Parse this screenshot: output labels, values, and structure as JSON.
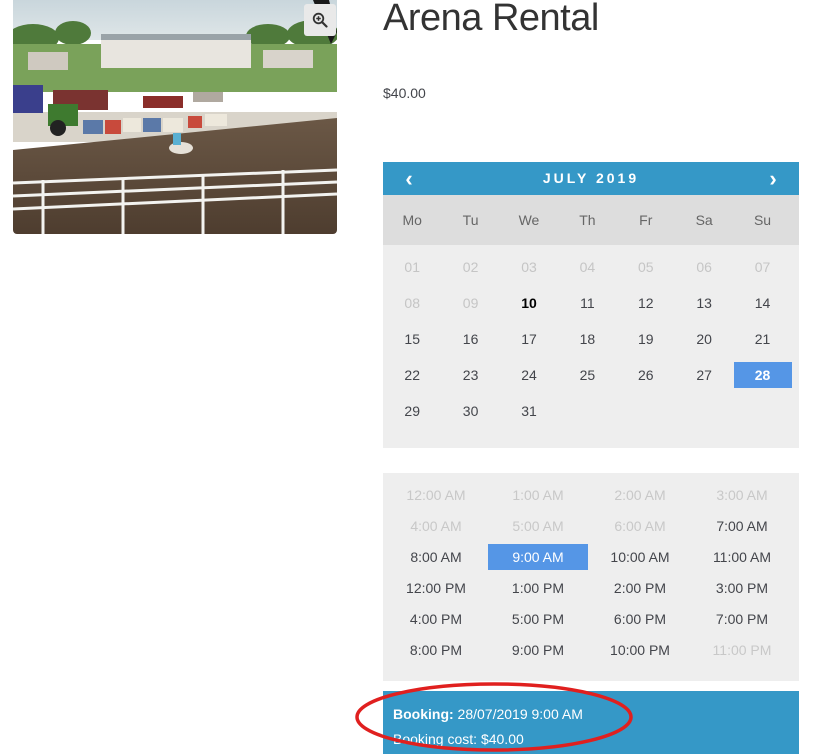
{
  "product": {
    "title": "Arena Rental",
    "price": "$40.00"
  },
  "calendar": {
    "month_label": "JULY 2019",
    "prev_glyph": "‹",
    "next_glyph": "›",
    "weekdays": [
      "Mo",
      "Tu",
      "We",
      "Th",
      "Fr",
      "Sa",
      "Su"
    ],
    "days": [
      {
        "label": "01",
        "state": "disabled"
      },
      {
        "label": "02",
        "state": "disabled"
      },
      {
        "label": "03",
        "state": "disabled"
      },
      {
        "label": "04",
        "state": "disabled"
      },
      {
        "label": "05",
        "state": "disabled"
      },
      {
        "label": "06",
        "state": "disabled"
      },
      {
        "label": "07",
        "state": "disabled"
      },
      {
        "label": "08",
        "state": "disabled"
      },
      {
        "label": "09",
        "state": "disabled"
      },
      {
        "label": "10",
        "state": "today"
      },
      {
        "label": "11",
        "state": "available"
      },
      {
        "label": "12",
        "state": "available"
      },
      {
        "label": "13",
        "state": "available"
      },
      {
        "label": "14",
        "state": "available"
      },
      {
        "label": "15",
        "state": "available"
      },
      {
        "label": "16",
        "state": "available"
      },
      {
        "label": "17",
        "state": "available"
      },
      {
        "label": "18",
        "state": "available"
      },
      {
        "label": "19",
        "state": "available"
      },
      {
        "label": "20",
        "state": "available"
      },
      {
        "label": "21",
        "state": "available"
      },
      {
        "label": "22",
        "state": "available"
      },
      {
        "label": "23",
        "state": "available"
      },
      {
        "label": "24",
        "state": "available"
      },
      {
        "label": "25",
        "state": "available"
      },
      {
        "label": "26",
        "state": "available"
      },
      {
        "label": "27",
        "state": "available"
      },
      {
        "label": "28",
        "state": "selected"
      },
      {
        "label": "29",
        "state": "available"
      },
      {
        "label": "30",
        "state": "available"
      },
      {
        "label": "31",
        "state": "available"
      }
    ]
  },
  "time_slots": [
    {
      "label": "12:00 AM",
      "state": "disabled"
    },
    {
      "label": "1:00 AM",
      "state": "disabled"
    },
    {
      "label": "2:00 AM",
      "state": "disabled"
    },
    {
      "label": "3:00 AM",
      "state": "disabled"
    },
    {
      "label": "4:00 AM",
      "state": "disabled"
    },
    {
      "label": "5:00 AM",
      "state": "disabled"
    },
    {
      "label": "6:00 AM",
      "state": "disabled"
    },
    {
      "label": "7:00 AM",
      "state": "available"
    },
    {
      "label": "8:00 AM",
      "state": "available"
    },
    {
      "label": "9:00 AM",
      "state": "selected"
    },
    {
      "label": "10:00 AM",
      "state": "available"
    },
    {
      "label": "11:00 AM",
      "state": "available"
    },
    {
      "label": "12:00 PM",
      "state": "available"
    },
    {
      "label": "1:00 PM",
      "state": "available"
    },
    {
      "label": "2:00 PM",
      "state": "available"
    },
    {
      "label": "3:00 PM",
      "state": "available"
    },
    {
      "label": "4:00 PM",
      "state": "available"
    },
    {
      "label": "5:00 PM",
      "state": "available"
    },
    {
      "label": "6:00 PM",
      "state": "available"
    },
    {
      "label": "7:00 PM",
      "state": "available"
    },
    {
      "label": "8:00 PM",
      "state": "available"
    },
    {
      "label": "9:00 PM",
      "state": "available"
    },
    {
      "label": "10:00 PM",
      "state": "available"
    },
    {
      "label": "11:00 PM",
      "state": "disabled"
    }
  ],
  "summary": {
    "booking_label": "Booking:",
    "booking_value": "28/07/2019 9:00 AM",
    "cost_label": "Booking cost:",
    "cost_value": "$40.00"
  },
  "icons": {
    "zoom": "zoom-in-icon",
    "prev": "chevron-left-icon",
    "next": "chevron-right-icon"
  },
  "colors": {
    "header_blue": "#3598c7",
    "selected_blue": "#5596e6",
    "panel_gray": "#eeeeee",
    "weekday_gray": "#dddddd",
    "annotation_red": "#e0201f"
  }
}
